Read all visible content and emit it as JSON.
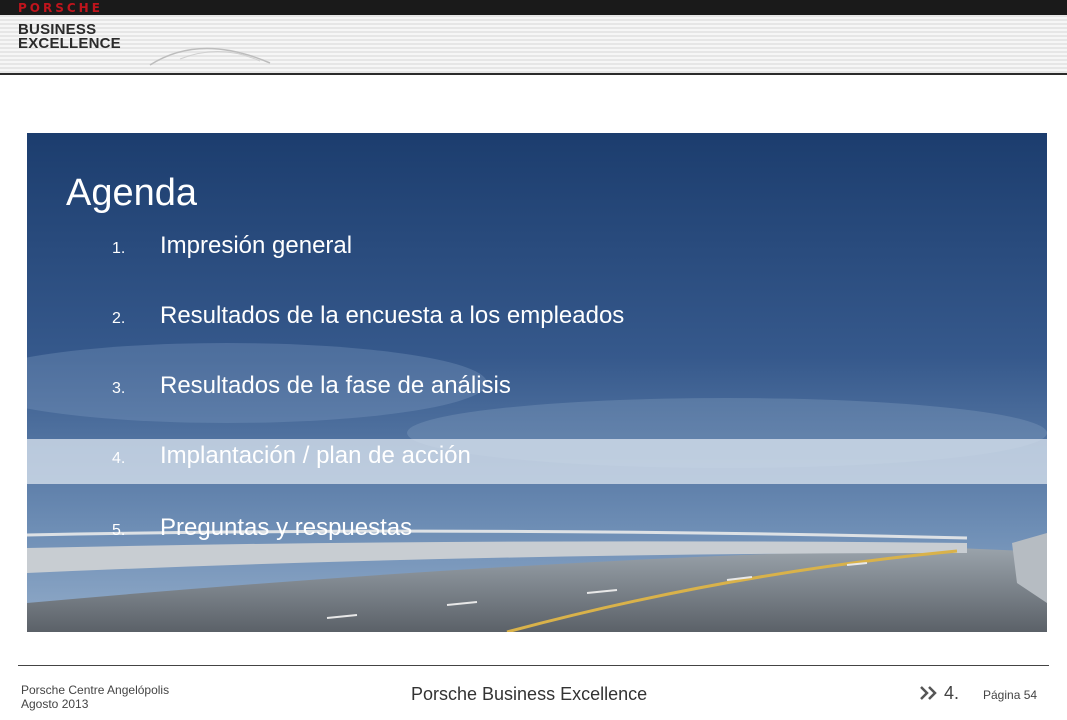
{
  "header": {
    "brand": "PORSCHE",
    "program_line1": "BUSINESS",
    "program_line2": "EXCELLENCE"
  },
  "slide": {
    "title": "Agenda",
    "items": [
      {
        "num": "1.",
        "label": "Impresión general"
      },
      {
        "num": "2.",
        "label": "Resultados de la encuesta a los empleados"
      },
      {
        "num": "3.",
        "label": "Resultados de la fase de análisis"
      },
      {
        "num": "4.",
        "label": "Implantación / plan de acción"
      },
      {
        "num": "5.",
        "label": "Preguntas y respuestas"
      }
    ],
    "highlighted_item": 4
  },
  "footer": {
    "centre": "Porsche Centre  Angelópolis",
    "date": "Agosto 2013",
    "program": "Porsche Business Excellence",
    "section": "4.",
    "page": "Página 54"
  },
  "colors": {
    "brand_red": "#c0141c",
    "sky_top": "#1c3d6e",
    "sky_bottom": "#7f9fc4",
    "highlight": "#d7e1ed"
  }
}
